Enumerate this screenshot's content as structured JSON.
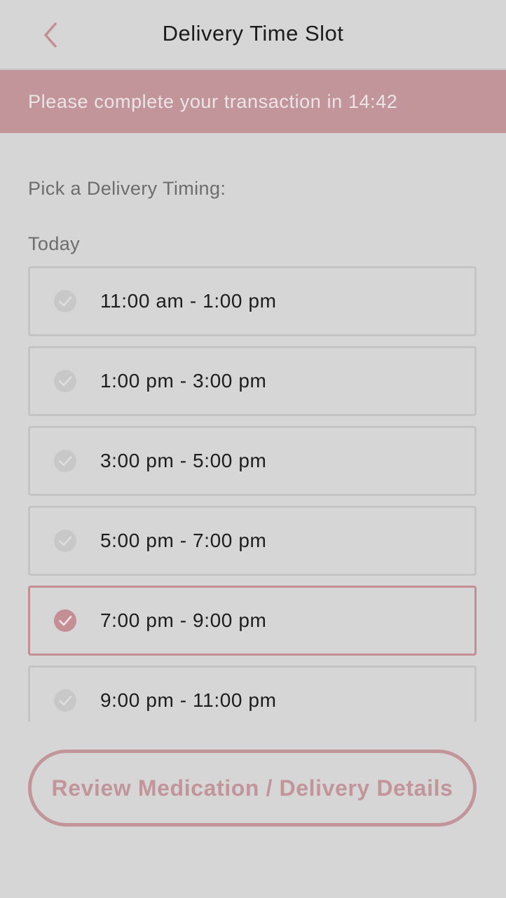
{
  "header": {
    "title": "Delivery Time Slot",
    "back_icon": "chevron-left-icon"
  },
  "banner": {
    "text": "Please complete your transaction in 14:42"
  },
  "pick_label": "Pick a Delivery Timing:",
  "day_label": "Today",
  "slots": [
    {
      "label": "11:00 am - 1:00 pm",
      "selected": false
    },
    {
      "label": "1:00 pm - 3:00 pm",
      "selected": false
    },
    {
      "label": "3:00 pm - 5:00 pm",
      "selected": false
    },
    {
      "label": "5:00 pm - 7:00 pm",
      "selected": false
    },
    {
      "label": "7:00 pm - 9:00 pm",
      "selected": true
    },
    {
      "label": "9:00 pm - 11:00 pm",
      "selected": false
    }
  ],
  "review_button": {
    "label": "Review Medication / Delivery Details"
  },
  "colors": {
    "accent": "#c2959b",
    "background": "#d6d6d6",
    "check_inactive": "#c8c8c8",
    "check_active": "#c48e95"
  }
}
